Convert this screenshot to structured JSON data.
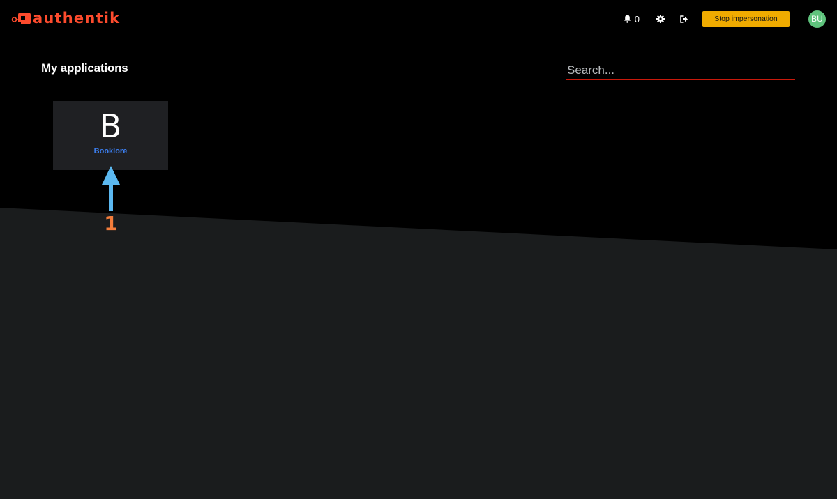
{
  "header": {
    "brand": "authentik",
    "notifications_count": "0",
    "stop_impersonation_label": "Stop impersonation",
    "avatar_initials": "BU",
    "icons": [
      "bell-icon",
      "gear-icon",
      "logout-icon"
    ]
  },
  "main": {
    "title": "My applications",
    "search": {
      "placeholder": "Search...",
      "value": ""
    },
    "applications": [
      {
        "icon_letter": "B",
        "name": "Booklore"
      }
    ]
  },
  "annotation": {
    "step_number": "1"
  },
  "colors": {
    "brand": "#fd4b2d",
    "impersonation_button": "#f0ab00",
    "avatar": "#5fc37d",
    "app_link": "#3c7ff0",
    "search_underline": "#c9190b",
    "annotation_arrow": "#5bb8f0",
    "annotation_number": "#f47d3b"
  }
}
